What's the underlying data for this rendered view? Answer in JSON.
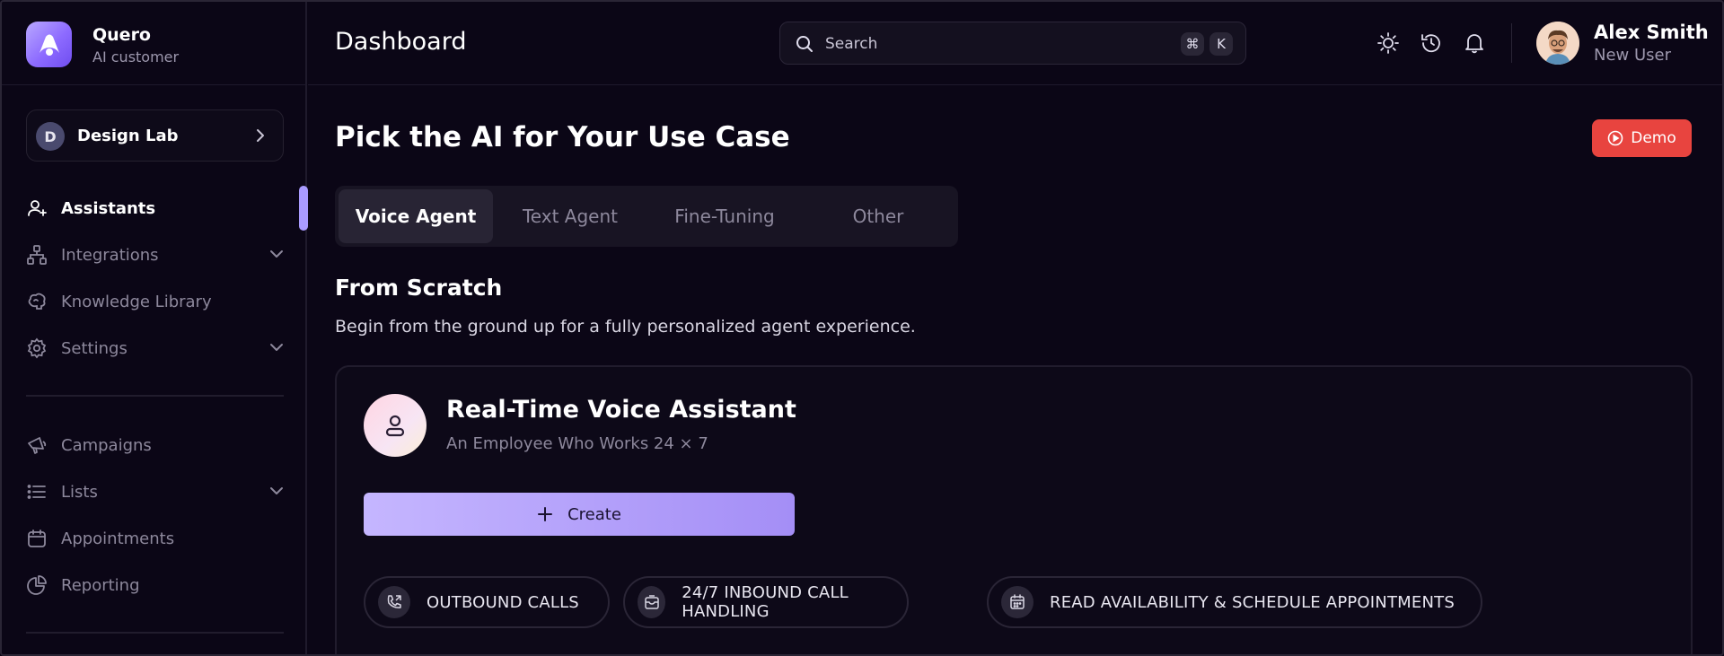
{
  "brand": {
    "name": "Quero",
    "subtitle": "AI customer"
  },
  "workspace": {
    "initial": "D",
    "name": "Design Lab"
  },
  "sidebar": {
    "items": [
      {
        "label": "Assistants",
        "icon": "user-plus-icon",
        "active": true
      },
      {
        "label": "Integrations",
        "icon": "hierarchy-icon",
        "expandable": true
      },
      {
        "label": "Knowledge Library",
        "icon": "brain-icon"
      },
      {
        "label": "Settings",
        "icon": "gear-icon",
        "expandable": true
      }
    ],
    "items2": [
      {
        "label": "Campaigns",
        "icon": "megaphone-icon"
      },
      {
        "label": "Lists",
        "icon": "list-icon",
        "expandable": true
      },
      {
        "label": "Appointments",
        "icon": "calendar-icon"
      },
      {
        "label": "Reporting",
        "icon": "pie-chart-icon"
      }
    ]
  },
  "header": {
    "title": "Dashboard",
    "search": {
      "placeholder": "Search",
      "shortcut_keys": [
        "⌘",
        "K"
      ]
    },
    "user": {
      "name": "Alex Smith",
      "role": "New User"
    }
  },
  "main": {
    "title": "Pick the AI for Your Use Case",
    "demo_label": "Demo",
    "tabs": [
      {
        "label": "Voice Agent",
        "active": true
      },
      {
        "label": "Text Agent"
      },
      {
        "label": "Fine-Tuning"
      },
      {
        "label": "Other"
      }
    ],
    "scratch": {
      "title": "From Scratch",
      "description": "Begin from the ground up for a fully personalized agent experience."
    },
    "card": {
      "title": "Real-Time Voice Assistant",
      "subtitle": "An Employee Who Works 24 × 7",
      "create_label": "Create",
      "features": [
        {
          "label": "OUTBOUND CALLS",
          "icon": "phone-outgoing-icon"
        },
        {
          "label": "24/7 INBOUND CALL HANDLING",
          "icon": "inbox-icon"
        },
        {
          "label": "READ AVAILABILITY & SCHEDULE APPOINTMENTS",
          "icon": "calendar-icon"
        }
      ]
    }
  },
  "colors": {
    "background": "#0b0616",
    "accent": "#a99bff",
    "demo": "#e8443f"
  }
}
